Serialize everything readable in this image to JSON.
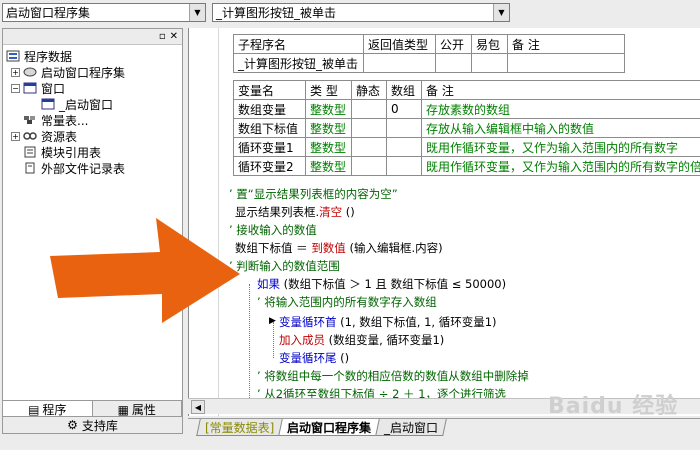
{
  "toolbar": {
    "left_combo": "启动窗口程序集",
    "right_combo": "_计算图形按钮_被单击"
  },
  "tree": {
    "items": [
      {
        "label": "程序数据",
        "level": 0,
        "expander": ""
      },
      {
        "label": "启动窗口程序集",
        "level": 1,
        "expander": "+"
      },
      {
        "label": "窗口",
        "level": 1,
        "expander": "−"
      },
      {
        "label": "_启动窗口",
        "level": 2,
        "expander": ""
      },
      {
        "label": "常量表...",
        "level": 1,
        "expander": ""
      },
      {
        "label": "资源表",
        "level": 1,
        "expander": "+"
      },
      {
        "label": "模块引用表",
        "level": 1,
        "expander": ""
      },
      {
        "label": "外部文件记录表",
        "level": 1,
        "expander": ""
      }
    ]
  },
  "left_tabs": {
    "program": "程序",
    "properties": "属性"
  },
  "support_label": "支持库",
  "sub_table": {
    "headers": [
      "子程序名",
      "返回值类型",
      "公开",
      "易包",
      "备 注"
    ],
    "row": [
      "_计算图形按钮_被单击",
      "",
      "",
      "",
      ""
    ]
  },
  "var_table": {
    "headers": [
      "变量名",
      "类 型",
      "静态",
      "数组",
      "备 注"
    ],
    "rows": [
      [
        "数组变量",
        "整数型",
        "",
        "0",
        "存放素数的数组"
      ],
      [
        "数组下标值",
        "整数型",
        "",
        "",
        "存放从输入编辑框中输入的数值"
      ],
      [
        "循环变量1",
        "整数型",
        "",
        "",
        "既用作循环变量，又作为输入范围内的所有数字"
      ],
      [
        "循环变量2",
        "整数型",
        "",
        "",
        "既用作循环变量，又作为输入范围内的所有数字的倍"
      ]
    ]
  },
  "code": {
    "l1": "’ 置“显示结果列表框的内容为空”",
    "l2a": "显示结果列表框.",
    "l2b": "清空",
    "l2c": " ()",
    "l3": "’ 接收输入的数值",
    "l4a": "数组下标值 ＝ ",
    "l4b": "到数值",
    "l4c": " (输入编辑框.内容)",
    "l5": "’ 判断输入的数值范围",
    "l6a": "如果",
    "l6b": " (数组下标值 ＞ 1 且 数组下标值 ≤ 50000)",
    "l7": "’ 将输入范围内的所有数字存入数组",
    "l8a": "变量循环首",
    "l8b": " (1, 数组下标值, 1, 循环变量1)",
    "l9a": "加入成员",
    "l9b": " (数组变量, 循环变量1)",
    "l10a": "变量循环尾",
    "l10b": " ()",
    "l11": "’ 将数组中每一个数的相应倍数的数值从数组中删除掉",
    "l12": "’ 从2循环至数组下标值 ÷ 2 ＋ 1，逐个进行筛选"
  },
  "bottom_tabs": [
    "[常量数据表]",
    "启动窗口程序集",
    "_启动窗口"
  ],
  "watermark": "Baidu 经验",
  "colors": {
    "arrow": "#e8620f",
    "keyword": "#0000c8",
    "type": "#008000",
    "comment": "#006400"
  }
}
